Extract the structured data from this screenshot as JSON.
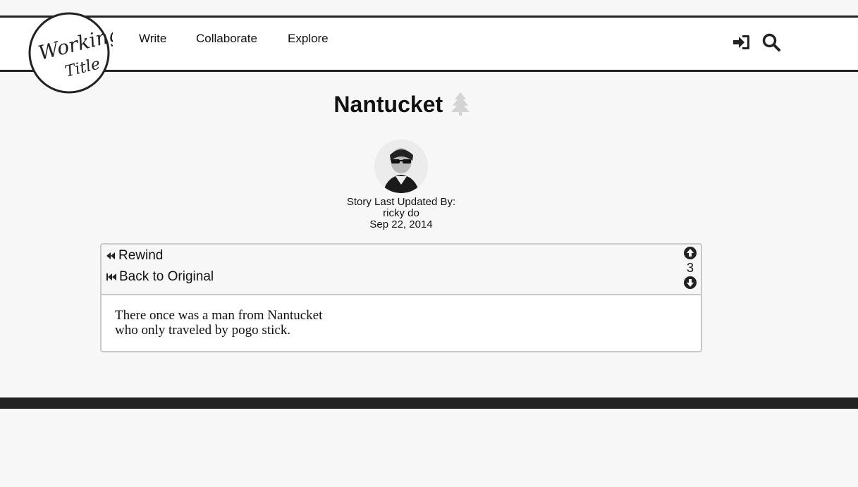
{
  "brand": {
    "logo_line1": "Working",
    "logo_line2": "Title"
  },
  "nav": {
    "items": [
      {
        "label": "Write"
      },
      {
        "label": "Collaborate"
      },
      {
        "label": "Explore"
      }
    ]
  },
  "header_icons": [
    "sign-in-icon",
    "search-icon"
  ],
  "story": {
    "title": "Nantucket",
    "title_icon": "tree-icon",
    "updated_label": "Story Last Updated By:",
    "author": "ricky do",
    "date": "Sep 22, 2014",
    "history": {
      "rewind_label": "Rewind",
      "original_label": "Back to Original"
    },
    "votes": 3,
    "lines": [
      "There once was a man from Nantucket",
      "who only traveled by pogo stick."
    ]
  },
  "colors": {
    "background": "#f7f7f7",
    "header_border": "#222222",
    "panel_border": "#c9c9c9",
    "tree_icon": "#d4d4d4"
  }
}
